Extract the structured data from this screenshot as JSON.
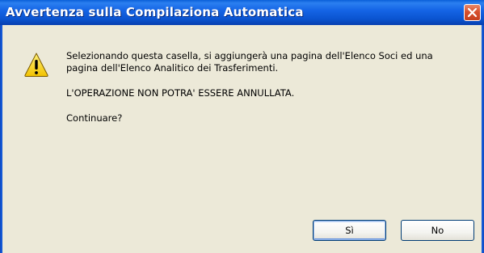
{
  "window": {
    "title": "Avvertenza sulla Compilaziona Automatica"
  },
  "icon": {
    "name": "warning-icon",
    "color": "#f2c200"
  },
  "message": {
    "line1": "Selezionando questa casella, si aggiungerà una pagina dell'Elenco Soci ed una",
    "line2": "pagina dell'Elenco Analitico dei Trasferimenti.",
    "line3": "L'OPERAZIONE NON POTRA' ESSERE ANNULLATA.",
    "line4": "Continuare?"
  },
  "buttons": {
    "yes_label": "Sì",
    "no_label": "No"
  },
  "colors": {
    "titlebar": "#0a54d0",
    "close": "#d7502e",
    "dialog_bg": "#ece9d8"
  }
}
